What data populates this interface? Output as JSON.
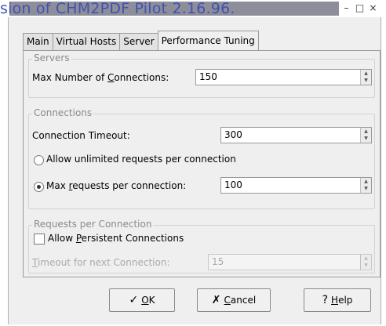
{
  "titlebar": {
    "overlay_text": "sion of CHM2PDF Pilot 2.16.96.",
    "minimize": "–",
    "maximize": "□",
    "close": "×"
  },
  "tabs": [
    {
      "label": "Main",
      "active": false
    },
    {
      "label": "Virtual Hosts",
      "active": false
    },
    {
      "label": "Server",
      "active": false
    },
    {
      "label": "Performance Tuning",
      "active": true
    }
  ],
  "servers": {
    "title": "Servers",
    "max_connections": {
      "pre": "Max Number of ",
      "u": "C",
      "post": "onnections:",
      "value": "150"
    }
  },
  "connections": {
    "title": "Connections",
    "timeout": {
      "label": "Connection Timeout:",
      "value": "300"
    },
    "unlimited": {
      "label": "Allow unlimited requests per connection",
      "selected": false
    },
    "max_requests": {
      "pre": "Max ",
      "u": "r",
      "post": "equests per connection:",
      "value": "100",
      "selected": true
    }
  },
  "requests": {
    "title": "Requests per Connection",
    "persistent": {
      "pre": "Allow ",
      "u": "P",
      "post": "ersistent Connections",
      "checked": false
    },
    "timeout_next": {
      "u": "T",
      "post": "imeout for next Connection:",
      "value": "15"
    }
  },
  "buttons": {
    "ok": {
      "u": "O",
      "post": "K",
      "icon": "✓"
    },
    "cancel": {
      "u": "C",
      "post": "ancel",
      "icon": "✗"
    },
    "help": {
      "u": "H",
      "post": "elp",
      "icon": "?"
    }
  }
}
